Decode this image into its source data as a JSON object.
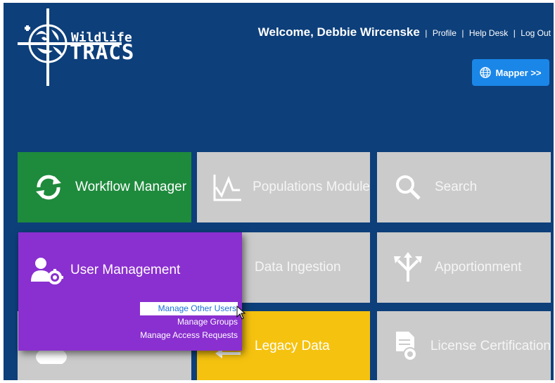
{
  "header": {
    "logo_line1": "Wildlife",
    "logo_line2": "TRACS",
    "welcome": "Welcome, Debbie Wircenske",
    "links": [
      "Profile",
      "Help Desk",
      "Log Out"
    ],
    "mapper_label": "Mapper >>"
  },
  "tiles": [
    {
      "label": "Workflow Manager",
      "icon": "refresh-icon"
    },
    {
      "label": "Populations Module",
      "icon": "line-chart-icon"
    },
    {
      "label": "Search",
      "icon": "search-icon"
    },
    {
      "label": "Data Ingestion",
      "icon": "data-icon"
    },
    {
      "label": "Apportionment",
      "icon": "split-arrows-icon"
    },
    {
      "label": "Legacy Data",
      "icon": "arrow-left-icon"
    },
    {
      "label": "License Certification",
      "icon": "certificate-icon"
    }
  ],
  "user_menu": {
    "title": "User Management",
    "items": [
      "Manage Other Users",
      "Manage Groups",
      "Manage Access Requests"
    ],
    "highlighted": "Manage Other Users"
  },
  "colors": {
    "background": "#0d3f7a",
    "green_tile": "#1e8a3c",
    "grey_tile": "#cbcbcb",
    "yellow_tile": "#f5c20f",
    "purple_menu": "#8a2fd0",
    "mapper_button": "#1a87e8"
  }
}
